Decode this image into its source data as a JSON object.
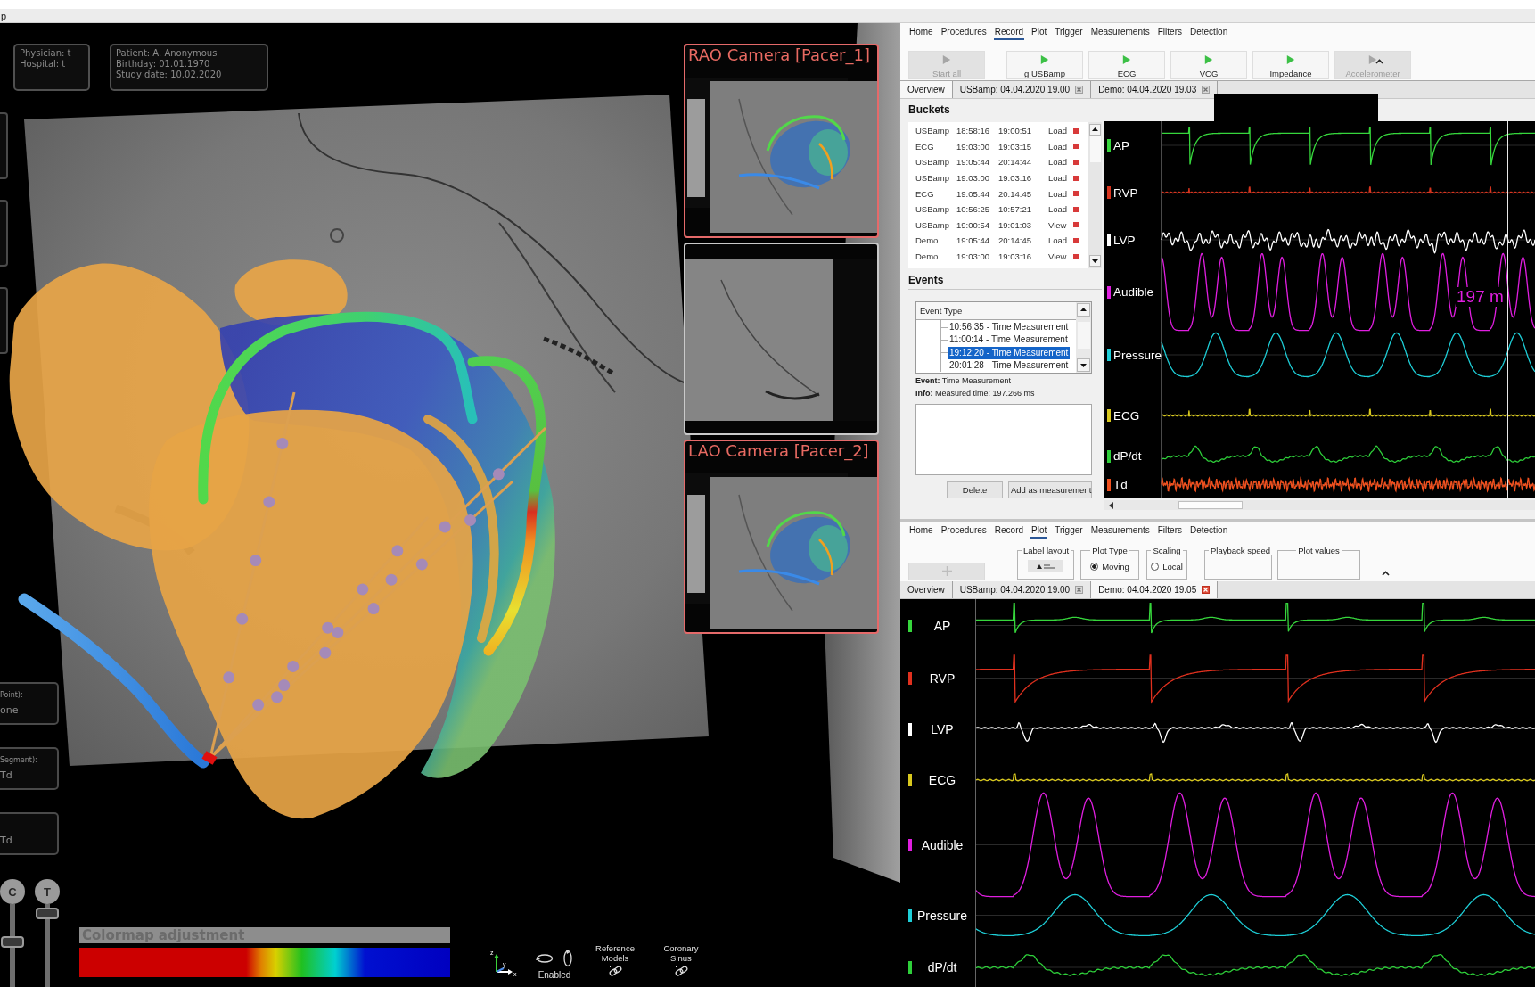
{
  "window": {
    "title": "p"
  },
  "viewer": {
    "info_boxes": [
      {
        "lines": [
          "Physician: t",
          "Hospital: t"
        ]
      },
      {
        "lines": [
          "Patient: A. Anonymous",
          "Birthday: 01.01.1970",
          "Study date: 10.02.2020"
        ]
      }
    ],
    "side_fields": [
      {
        "label": "Point):",
        "value": "one"
      },
      {
        "label": "Segment):",
        "value": "Td"
      },
      {
        "value": "Td"
      }
    ],
    "sliders": [
      {
        "label": "C",
        "level": 0.55
      },
      {
        "label": "T",
        "level": 0.95
      }
    ],
    "cameras": [
      {
        "kind": "model",
        "title": "RAO Camera [Pacer_1]"
      },
      {
        "kind": "fluoroscopy"
      },
      {
        "kind": "model",
        "title": "LAO Camera [Pacer_2]"
      }
    ],
    "colormap": {
      "title": "Colormap adjustment"
    },
    "view_controls": {
      "axes": [
        "z",
        "y",
        "x"
      ],
      "rotation": {
        "label": "Enabled"
      },
      "links": [
        "Reference Models",
        "Coronary Sinus"
      ]
    }
  },
  "record_panel": {
    "menu": [
      {
        "label": "Home",
        "selected": false
      },
      {
        "label": "Procedures",
        "selected": false
      },
      {
        "label": "Record",
        "selected": true
      },
      {
        "label": "Plot",
        "selected": false
      },
      {
        "label": "Trigger",
        "selected": false
      },
      {
        "label": "Measurements",
        "selected": false
      },
      {
        "label": "Filters",
        "selected": false
      },
      {
        "label": "Detection",
        "selected": false
      }
    ],
    "toolbar": [
      {
        "label": "Start all",
        "disabled": true
      },
      {
        "label": "g.USBamp",
        "disabled": false
      },
      {
        "label": "ECG",
        "disabled": false
      },
      {
        "label": "VCG",
        "disabled": false
      },
      {
        "label": "Impedance",
        "disabled": false
      },
      {
        "label": "Accelerometer",
        "disabled": true
      }
    ],
    "tabs": [
      {
        "label": "Overview",
        "selected": true,
        "closable": false
      },
      {
        "label": "USBamp: 04.04.2020 19.00",
        "selected": false,
        "closable": true
      },
      {
        "label": "Demo: 04.04.2020 19.03",
        "selected": false,
        "closable": true
      }
    ],
    "buckets": {
      "title": "Buckets",
      "rows": [
        {
          "source": "USBamp",
          "start": "18:58:16",
          "end": "19:00:51",
          "action": "Load"
        },
        {
          "source": "ECG",
          "start": "19:03:00",
          "end": "19:03:15",
          "action": "Load"
        },
        {
          "source": "USBamp",
          "start": "19:05:44",
          "end": "20:14:44",
          "action": "Load"
        },
        {
          "source": "USBamp",
          "start": "19:03:00",
          "end": "19:03:16",
          "action": "Load"
        },
        {
          "source": "ECG",
          "start": "19:05:44",
          "end": "20:14:45",
          "action": "Load"
        },
        {
          "source": "USBamp",
          "start": "10:56:25",
          "end": "10:57:21",
          "action": "Load"
        },
        {
          "source": "USBamp",
          "start": "19:00:54",
          "end": "19:01:03",
          "action": "View"
        },
        {
          "source": "Demo",
          "start": "19:05:44",
          "end": "20:14:45",
          "action": "Load"
        },
        {
          "source": "Demo",
          "start": "19:03:00",
          "end": "19:03:16",
          "action": "View"
        }
      ]
    },
    "events": {
      "title": "Events",
      "column": "Event Type",
      "items": [
        {
          "label": "10:56:35 - Time Measurement",
          "selected": false
        },
        {
          "label": "11:00:14 - Time Measurement",
          "selected": false
        },
        {
          "label": "19:12:20 - Time Measurement",
          "selected": true
        },
        {
          "label": "20:01:28 - Time Measurement",
          "selected": false
        }
      ],
      "details": [
        "**Event:** Time Measurement",
        "**Info:** Measured time: 197.266 ms"
      ],
      "buttons": [
        "Delete",
        "Add as measurement"
      ]
    },
    "plot": {
      "channels": [
        {
          "label": "AP",
          "color": "#36d63c",
          "kind": "notch"
        },
        {
          "label": "RVP",
          "color": "#d8341e",
          "kind": "flat"
        },
        {
          "label": "LVP",
          "color": "#ffffff",
          "kind": "noisy"
        },
        {
          "label": "Audible",
          "color": "#e01ee0",
          "kind": "double-peak"
        },
        {
          "label": "Pressure",
          "color": "#1ecfd8",
          "kind": "smooth"
        },
        {
          "label": "ECG",
          "color": "#d8c81e",
          "kind": "flat"
        },
        {
          "label": "dP/dt",
          "color": "#2ecf3a",
          "kind": "ripple"
        },
        {
          "label": "Td",
          "color": "#f0501e",
          "kind": "noise"
        }
      ],
      "readout": "197 m"
    }
  },
  "plot_panel": {
    "menu": [
      {
        "label": "Home",
        "selected": false
      },
      {
        "label": "Procedures",
        "selected": false
      },
      {
        "label": "Record",
        "selected": false
      },
      {
        "label": "Plot",
        "selected": true
      },
      {
        "label": "Trigger",
        "selected": false
      },
      {
        "label": "Measurements",
        "selected": false
      },
      {
        "label": "Filters",
        "selected": false
      },
      {
        "label": "Detection",
        "selected": false
      }
    ],
    "toolbar": {
      "add_button": {
        "disabled": true
      },
      "groups": [
        {
          "legend": "Label layout",
          "kind": "button"
        },
        {
          "legend": "Plot Type",
          "kind": "radio",
          "option": {
            "label": "Moving",
            "selected": true
          }
        },
        {
          "legend": "Scaling",
          "kind": "radio",
          "option": {
            "label": "Local",
            "selected": false
          }
        },
        {
          "legend": "Playback speed",
          "kind": "blank"
        },
        {
          "legend": "Plot values",
          "kind": "blank"
        }
      ]
    },
    "tabs": [
      {
        "label": "Overview",
        "selected": false,
        "closable": false
      },
      {
        "label": "USBamp: 04.04.2020 19.00",
        "selected": false,
        "closable": true
      },
      {
        "label": "Demo: 04.04.2020 19.05",
        "selected": true,
        "closable": true
      }
    ],
    "plot": {
      "channels": [
        {
          "label": "AP",
          "color": "#36d63c",
          "kind": "spike"
        },
        {
          "label": "RVP",
          "color": "#e0301e",
          "kind": "decay"
        },
        {
          "label": "LVP",
          "color": "#ffffff",
          "kind": "dip"
        },
        {
          "label": "ECG",
          "color": "#d8c81e",
          "kind": "flat"
        },
        {
          "label": "Audible",
          "color": "#e01ee0",
          "kind": "double-peak"
        },
        {
          "label": "Pressure",
          "color": "#1ecfd8",
          "kind": "smooth"
        },
        {
          "label": "dP/dt",
          "color": "#2ecf3a",
          "kind": "ripple"
        }
      ]
    }
  }
}
